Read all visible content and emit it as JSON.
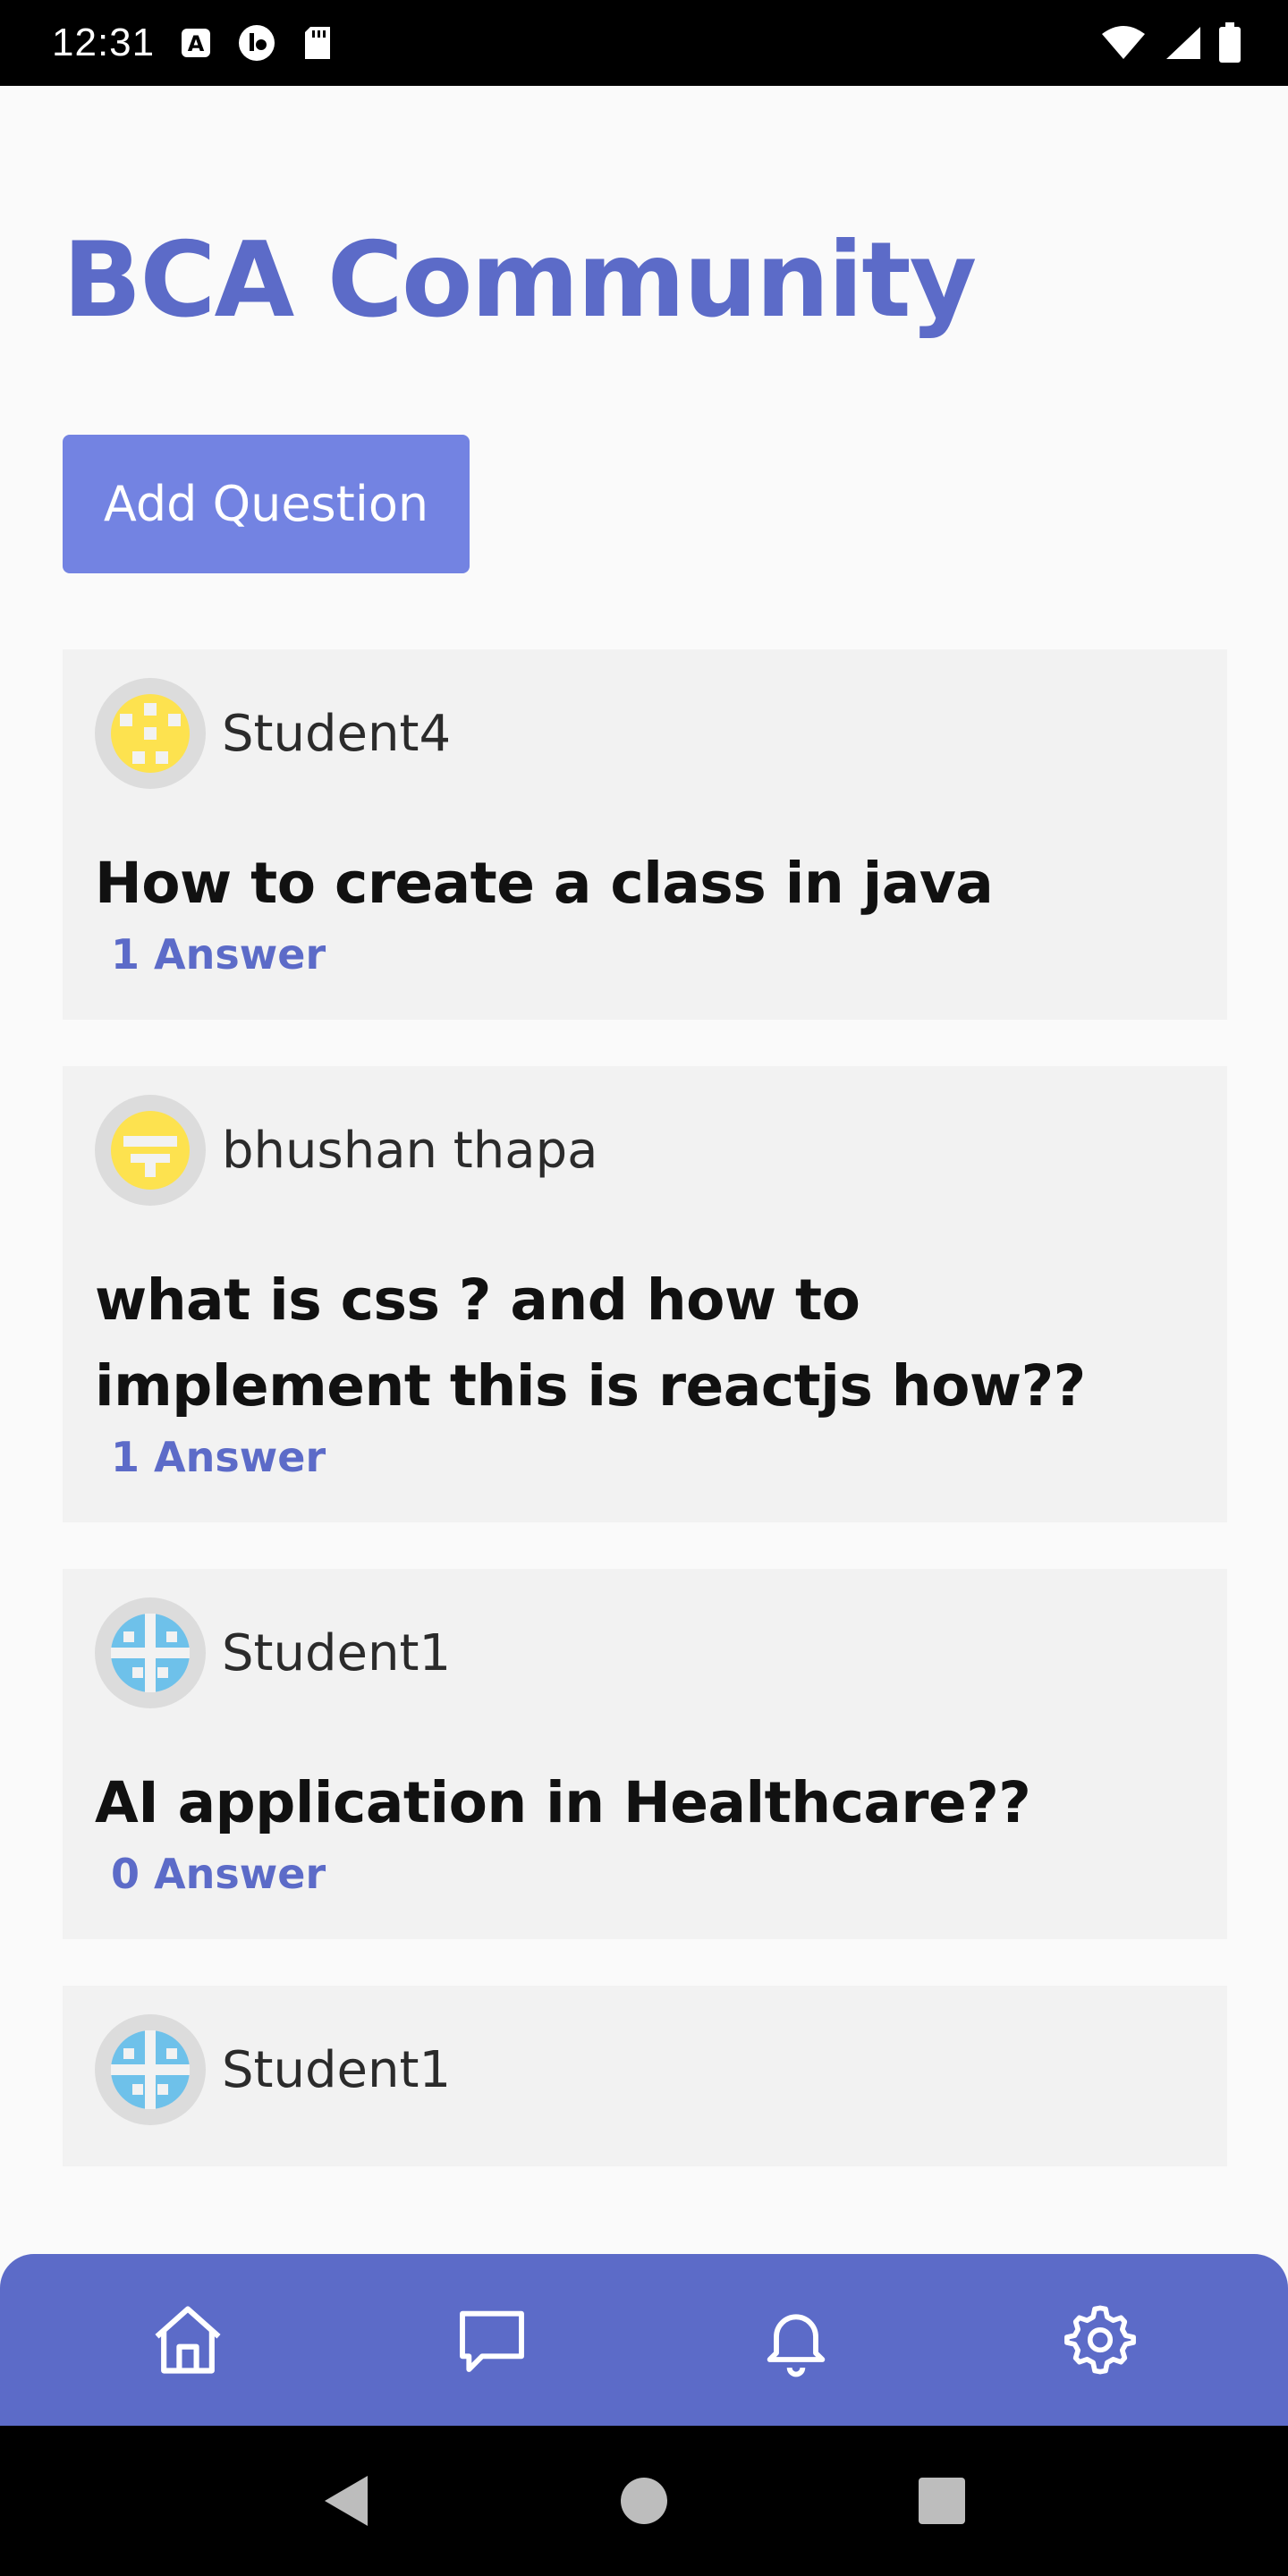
{
  "status_bar": {
    "time": "12:31",
    "left_icons": [
      "a-badge-icon",
      "sync-icon",
      "sd-card-icon"
    ],
    "right_icons": [
      "wifi-icon",
      "signal-icon",
      "battery-icon"
    ]
  },
  "app": {
    "title": "BCA Community",
    "add_question_label": "Add Question"
  },
  "colors": {
    "primary": "#5c6bc8",
    "button": "#7383e2",
    "card": "#f2f2f2",
    "background": "#fafafa"
  },
  "posts": [
    {
      "author": "Student4",
      "question": "How to create a class in java",
      "answers": "1 Answer",
      "avatar": "yellow-identicon"
    },
    {
      "author": "bhushan thapa",
      "question": "what is css ? and how to implement this is reactjs how??",
      "answers": "1 Answer",
      "avatar": "yellow-identicon"
    },
    {
      "author": "Student1",
      "question": "AI application in Healthcare??",
      "answers": "0 Answer",
      "avatar": "blue-identicon"
    },
    {
      "author": "Student1",
      "question": "",
      "answers": "",
      "avatar": "blue-identicon"
    }
  ],
  "bottom_nav": {
    "items": [
      "home-icon",
      "chat-icon",
      "bell-icon",
      "settings-icon"
    ]
  },
  "system_nav": {
    "items": [
      "back-icon",
      "home-circle-icon",
      "recents-icon"
    ]
  }
}
